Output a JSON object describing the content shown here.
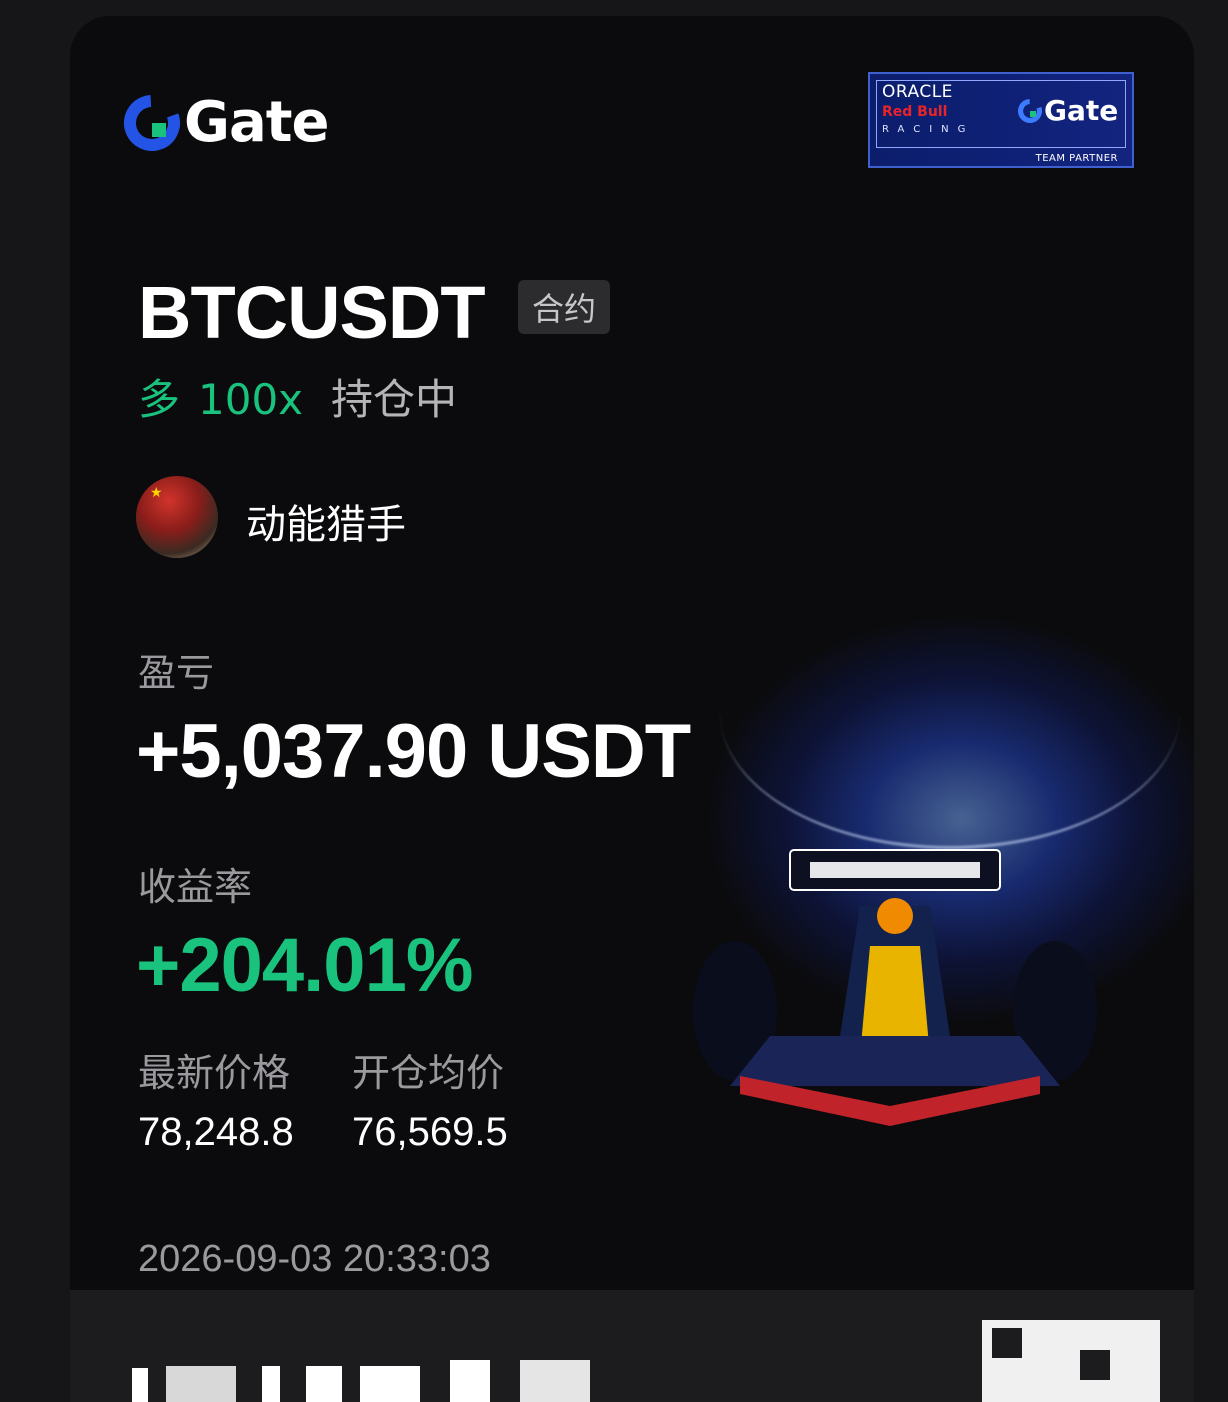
{
  "brand": {
    "name": "Gate",
    "logo_icon": "gate-logo-icon",
    "accent_color": "#2354e6"
  },
  "partner_badge": {
    "oracle": "ORACLE",
    "redbull": "Red Bull",
    "racing": "RACING",
    "gate": "Gate",
    "team_partner": "TEAM PARTNER"
  },
  "position": {
    "symbol": "BTCUSDT",
    "type_tag": "合约",
    "side": "多",
    "leverage": "100x",
    "status": "持仓中"
  },
  "user": {
    "name": "动能猎手",
    "avatar_icon": "avatar-image"
  },
  "pnl": {
    "label": "盈亏",
    "value": "+5,037.90 USDT"
  },
  "roi": {
    "label": "收益率",
    "value": "+204.01%"
  },
  "prices": {
    "last_label": "最新价格",
    "last_value": "78,248.8",
    "entry_label": "开仓均价",
    "entry_value": "76,569.5"
  },
  "timestamp": "2026-09-03 20:33:03",
  "colors": {
    "positive": "#19c37d",
    "background": "#0b0b0d",
    "muted_text": "#9a9a9e"
  }
}
